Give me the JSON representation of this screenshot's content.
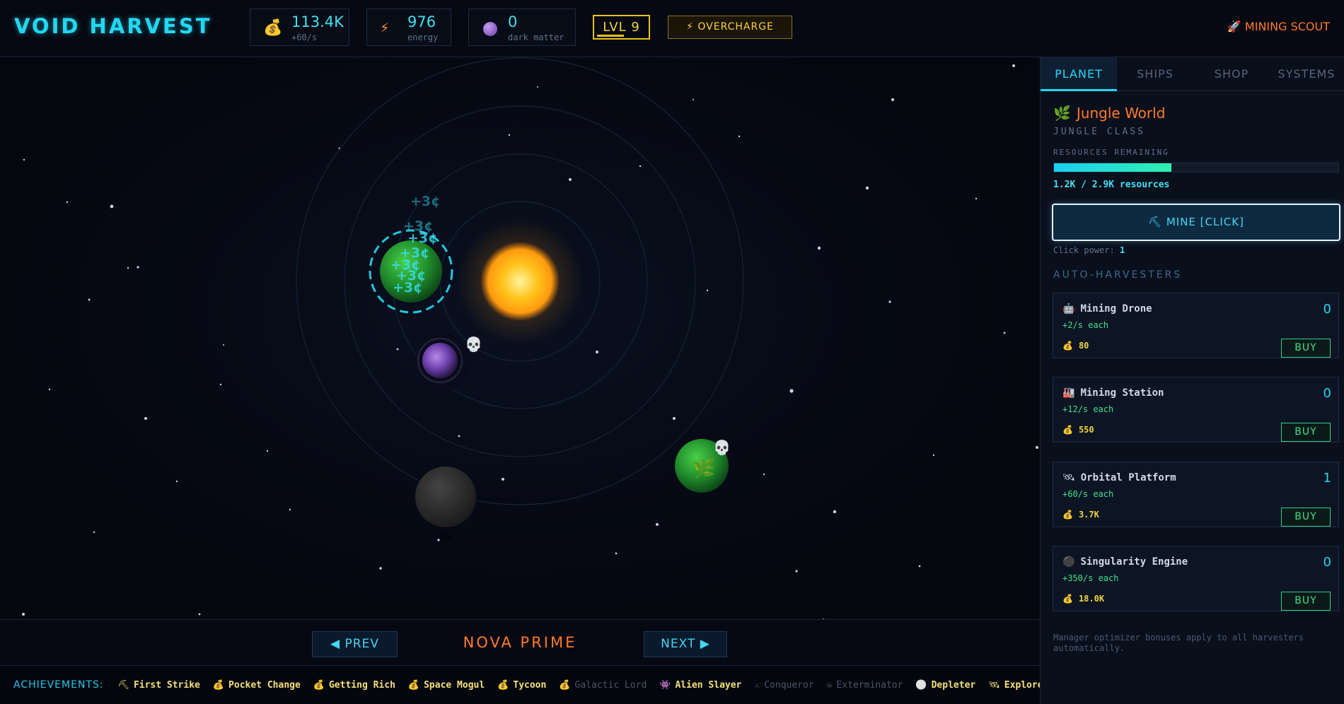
{
  "header": {
    "logo": "VOID HARVEST",
    "credits": {
      "icon": "money-bag-icon",
      "value": "113.4K",
      "rate": "+60/s"
    },
    "energy": {
      "icon": "lightning-icon",
      "value": "976",
      "label": "energy"
    },
    "dark_matter": {
      "icon": "dark-matter-orb-icon",
      "value": "0",
      "label": "dark matter"
    },
    "level": "LVL 9",
    "overcharge": "⚡ OVERCHARGE",
    "ship": "🚀 MINING SCOUT"
  },
  "space": {
    "floaters": [
      "+3¢",
      "+3¢",
      "+3¢",
      "+3¢",
      "+3¢",
      "+3¢",
      "+3¢"
    ],
    "nav": {
      "prev": "◀ PREV",
      "next": "NEXT ▶",
      "system_name": "NOVA PRIME"
    }
  },
  "achievements": {
    "label": "ACHIEVEMENTS:",
    "items": [
      {
        "icon": "⛏",
        "name": "First Strike",
        "unlocked": true
      },
      {
        "icon": "💰",
        "name": "Pocket Change",
        "unlocked": true
      },
      {
        "icon": "💰",
        "name": "Getting Rich",
        "unlocked": true
      },
      {
        "icon": "💰",
        "name": "Space Mogul",
        "unlocked": true
      },
      {
        "icon": "💰",
        "name": "Tycoon",
        "unlocked": true
      },
      {
        "icon": "💰",
        "name": "Galactic Lord",
        "unlocked": false
      },
      {
        "icon": "👾",
        "name": "Alien Slayer",
        "unlocked": true
      },
      {
        "icon": "⚔",
        "name": "Conqueror",
        "unlocked": false
      },
      {
        "icon": "☠",
        "name": "Exterminator",
        "unlocked": false
      },
      {
        "icon": "⚪",
        "name": "Depleter",
        "unlocked": true
      },
      {
        "icon": "🛰",
        "name": "Explorer",
        "unlocked": true
      },
      {
        "icon": "🟣",
        "name": "",
        "unlocked": true
      }
    ]
  },
  "panel": {
    "tabs": [
      "PLANET",
      "SHIPS",
      "SHOP",
      "SYSTEMS"
    ],
    "active_tab": "PLANET",
    "planet": {
      "icon": "🌿",
      "name": "Jungle World",
      "class": "JUNGLE CLASS",
      "resources_label": "RESOURCES REMAINING",
      "resources_fraction": 0.414,
      "resources_text": "1.2K / 2.9K resources"
    },
    "mine_button": "⛏ MINE [CLICK]",
    "click_power_label": "Click power:",
    "click_power_value": "1",
    "harvesters_heading": "AUTO-HARVESTERS",
    "harvesters": [
      {
        "icon": "🤖",
        "name": "Mining Drone",
        "rate": "+2/s each",
        "cost": "80",
        "count": "0",
        "buy": "BUY"
      },
      {
        "icon": "🏭",
        "name": "Mining Station",
        "rate": "+12/s each",
        "cost": "550",
        "count": "0",
        "buy": "BUY"
      },
      {
        "icon": "🛰",
        "name": "Orbital Platform",
        "rate": "+60/s each",
        "cost": "3.7K",
        "count": "1",
        "buy": "BUY"
      },
      {
        "icon": "⚫",
        "name": "Singularity Engine",
        "rate": "+350/s each",
        "cost": "18.0K",
        "count": "0",
        "buy": "BUY"
      }
    ],
    "manager_note": "Manager optimizer bonuses apply to all harvesters automatically."
  },
  "colors": {
    "accent": "#22d8f0",
    "orange": "#ff7a2a",
    "gold": "#f1d33a",
    "green": "#3ee08a"
  }
}
